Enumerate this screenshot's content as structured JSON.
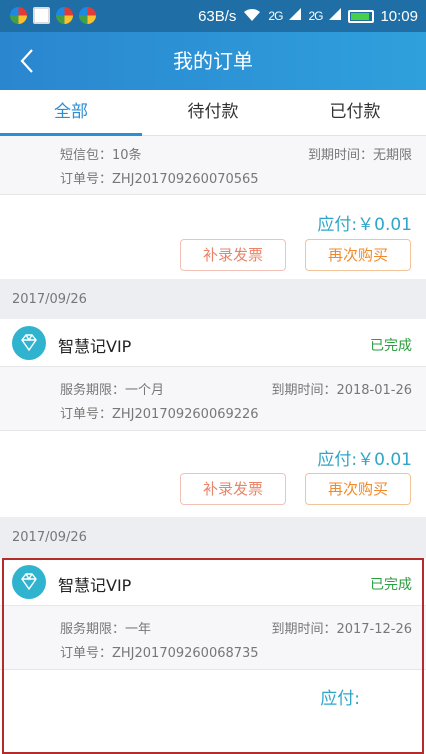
{
  "status_bar": {
    "speed": "63B/s",
    "net1": "2G",
    "net2": "2G",
    "time": "10:09"
  },
  "header": {
    "title": "我的订单",
    "back_icon": "chevron-left-icon"
  },
  "tabs": [
    {
      "label": "全部",
      "active": true
    },
    {
      "label": "待付款",
      "active": false
    },
    {
      "label": "已付款",
      "active": false
    }
  ],
  "colors": {
    "accent": "#2b8fd6",
    "price": "#2fa6c9",
    "done": "#2c9e3f",
    "rebuy": "#f08a2c",
    "invoice": "#e8856a"
  },
  "orders": [
    {
      "left_label": "短信包：10条",
      "right_label": "到期时间：无期限",
      "order_no": "订单号：ZHJ201709260070565",
      "price": "应付:￥0.01",
      "invoice_btn": "补录发票",
      "rebuy_btn": "再次购买"
    },
    {
      "date": "2017/09/26",
      "product": "智慧记VIP",
      "status": "已完成",
      "left_label": "服务期限：一个月",
      "right_label": "到期时间：2018-01-26",
      "order_no": "订单号：ZHJ201709260069226",
      "price": "应付:￥0.01",
      "invoice_btn": "补录发票",
      "rebuy_btn": "再次购买"
    },
    {
      "date": "2017/09/26",
      "product": "智慧记VIP",
      "status": "已完成",
      "left_label": "服务期限：一年",
      "right_label": "到期时间：2017-12-26",
      "order_no": "订单号：ZHJ201709260068735",
      "price": "应付:"
    }
  ]
}
